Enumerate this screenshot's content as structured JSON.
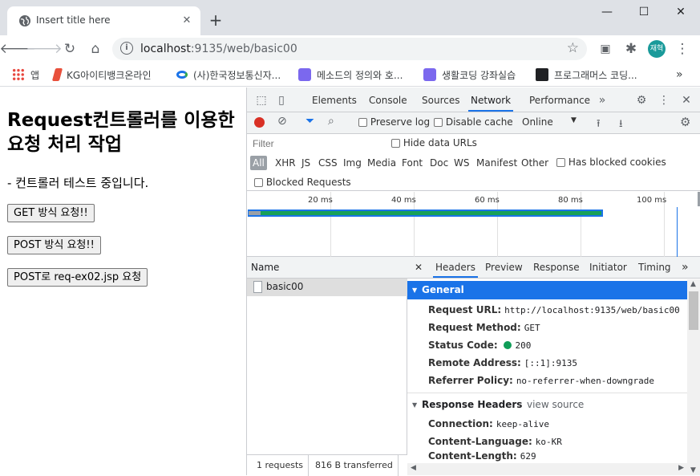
{
  "browser": {
    "tab_title": "Insert title here",
    "url_host": "localhost",
    "url_path": ":9135/web/basic00",
    "profile_initials": "재혁"
  },
  "bookmarks": [
    {
      "label": "앱",
      "color": "#e8453c"
    },
    {
      "label": "KG아이티뱅크온라인",
      "color": "#e8503c"
    },
    {
      "label": "(사)한국정보통신자...",
      "color": "#1a73e8"
    },
    {
      "label": "메소드의 정의와 호...",
      "color": "#7b68ee"
    },
    {
      "label": "생활코딩 강좌실습",
      "color": "#7b68ee"
    },
    {
      "label": "프로그래머스 코딩...",
      "color": "#202124"
    }
  ],
  "page": {
    "heading": "Request컨트롤러를 이용한 요청 처리 작업",
    "description": "- 컨트롤러 테스트 중입니다.",
    "buttons": [
      "GET 방식 요청!!",
      "POST 방식 요청!!",
      "POST로 req-ex02.jsp 요청"
    ]
  },
  "devtools": {
    "tabs": [
      "Elements",
      "Console",
      "Sources",
      "Network",
      "Performance"
    ],
    "active_tab": "Network",
    "preserve_log": "Preserve log",
    "disable_cache": "Disable cache",
    "throttle": "Online",
    "filter_placeholder": "Filter",
    "hide_data_urls": "Hide data URLs",
    "types": [
      "All",
      "XHR",
      "JS",
      "CSS",
      "Img",
      "Media",
      "Font",
      "Doc",
      "WS",
      "Manifest",
      "Other"
    ],
    "has_blocked_cookies": "Has blocked cookies",
    "blocked_requests": "Blocked Requests",
    "timeline_ticks": [
      "20 ms",
      "40 ms",
      "60 ms",
      "80 ms",
      "100 ms"
    ],
    "name_header": "Name",
    "requests": [
      "basic00"
    ],
    "status_requests": "1 requests",
    "status_transferred": "816 B transferred",
    "detail_tabs": [
      "Headers",
      "Preview",
      "Response",
      "Initiator",
      "Timing"
    ],
    "general_title": "General",
    "general": [
      {
        "k": "Request URL:",
        "v": "http://localhost:9135/web/basic00"
      },
      {
        "k": "Request Method:",
        "v": "GET"
      },
      {
        "k": "Status Code:",
        "v": "200"
      },
      {
        "k": "Remote Address:",
        "v": "[::1]:9135"
      },
      {
        "k": "Referrer Policy:",
        "v": "no-referrer-when-downgrade"
      }
    ],
    "response_headers_title": "Response Headers",
    "view_source": "view source",
    "response_headers": [
      {
        "k": "Connection:",
        "v": "keep-alive"
      },
      {
        "k": "Content-Language:",
        "v": "ko-KR"
      },
      {
        "k": "Content-Length:",
        "v": "629"
      }
    ],
    "colors": {
      "accent": "#1a73e8",
      "record": "#d93025",
      "status_ok": "#0f9d58",
      "waterfall": "#18a058"
    }
  }
}
